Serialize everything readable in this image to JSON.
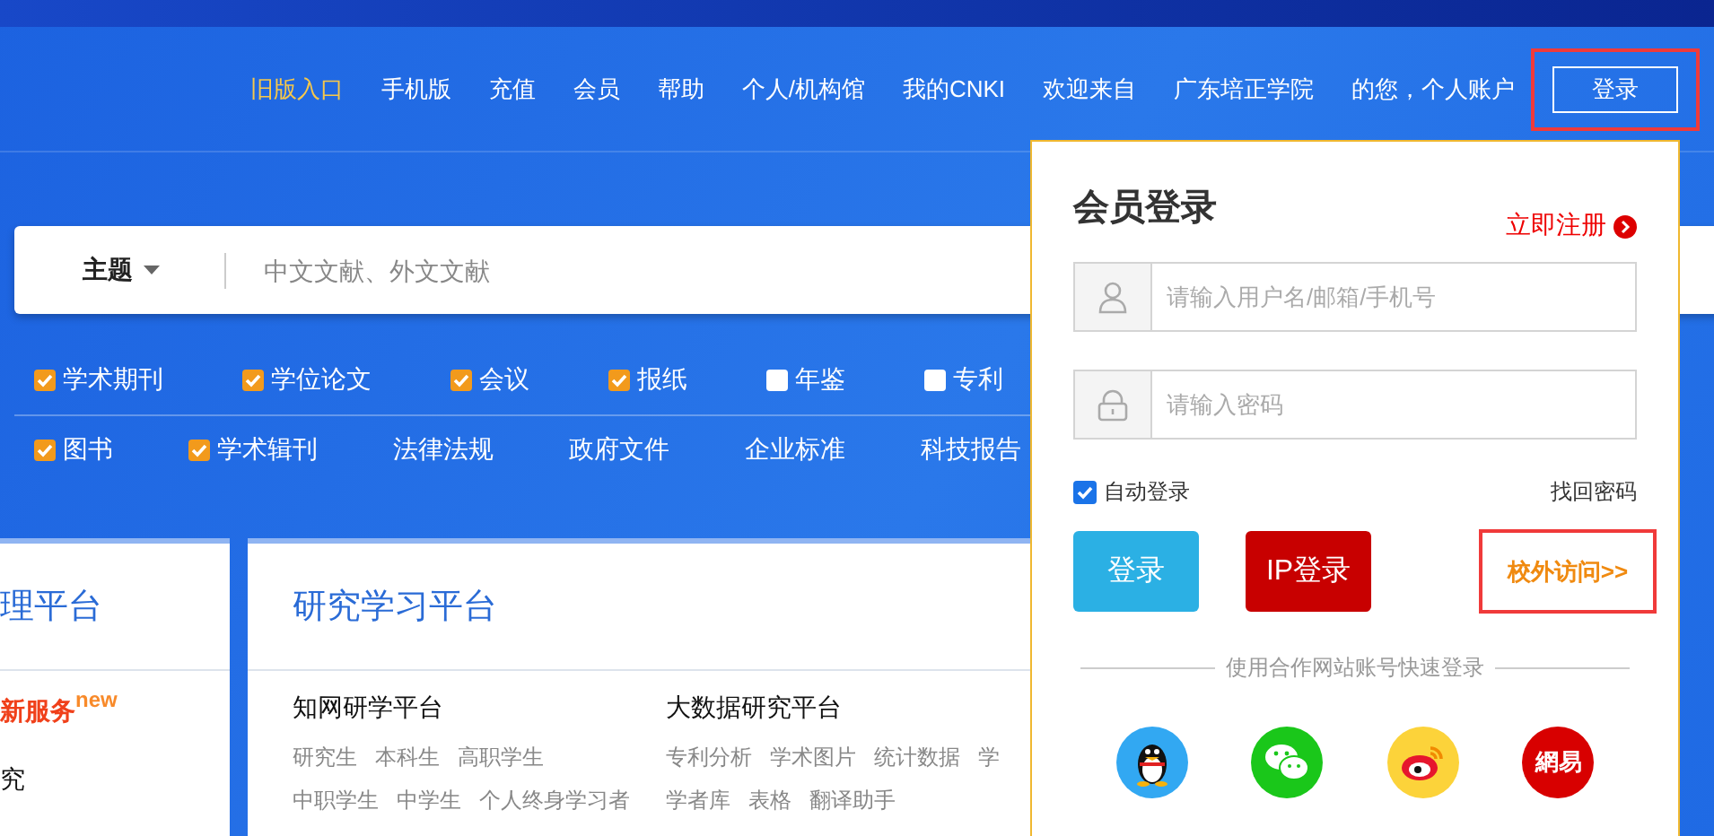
{
  "nav": {
    "links": [
      {
        "label": "旧版入口",
        "kind": "highlight"
      },
      {
        "label": "手机版",
        "kind": "plain"
      },
      {
        "label": "充值",
        "kind": "plain"
      },
      {
        "label": "会员",
        "kind": "plain"
      },
      {
        "label": "帮助",
        "kind": "plain"
      },
      {
        "label": "个人/机构馆",
        "kind": "plain"
      },
      {
        "label": "我的CNKI",
        "kind": "plain"
      }
    ],
    "welcome": "欢迎来自",
    "institution": "广东培正学院",
    "account": "的您，个人账户",
    "login_button": "登录"
  },
  "search": {
    "field_selector": "主题",
    "placeholder": "中文文献、外文文献"
  },
  "databases": [
    [
      {
        "label": "学术期刊",
        "kind": "checkbox",
        "checked": true
      },
      {
        "label": "学位论文",
        "kind": "checkbox",
        "checked": true
      },
      {
        "label": "会议",
        "kind": "checkbox",
        "checked": true
      },
      {
        "label": "报纸",
        "kind": "checkbox",
        "checked": true
      },
      {
        "label": "年鉴",
        "kind": "checkbox",
        "checked": false
      },
      {
        "label": "专利",
        "kind": "checkbox",
        "checked": false
      }
    ],
    [
      {
        "label": "图书",
        "kind": "checkbox",
        "checked": true
      },
      {
        "label": "学术辑刊",
        "kind": "checkbox",
        "checked": true
      },
      {
        "label": "法律法规",
        "kind": "link"
      },
      {
        "label": "政府文件",
        "kind": "link"
      },
      {
        "label": "企业标准",
        "kind": "link"
      },
      {
        "label": "科技报告",
        "kind": "link"
      }
    ]
  ],
  "panels": [
    {
      "title": "理平台",
      "sections": [
        {
          "heading": "新服务",
          "badge": "new",
          "kind": "promo"
        },
        {
          "heading": "究",
          "kind": "plain"
        }
      ]
    },
    {
      "title": "研究学习平台",
      "sections": [
        {
          "heading": "知网研学平台",
          "kind": "plain",
          "links": [
            [
              "研究生",
              "本科生",
              "高职学生"
            ],
            [
              "中职学生",
              "中学生",
              "个人终身学习者"
            ]
          ]
        },
        {
          "heading": "大数据研究平台",
          "kind": "plain",
          "links": [
            [
              "专利分析",
              "学术图片",
              "统计数据",
              "学"
            ],
            [
              "学者库",
              "表格",
              "翻译助手"
            ]
          ]
        }
      ]
    }
  ],
  "login": {
    "title": "会员登录",
    "register": "立即注册",
    "username_placeholder": "请输入用户名/邮箱/手机号",
    "password_placeholder": "请输入密码",
    "auto_login": {
      "label": "自动登录",
      "checked": true
    },
    "forgot_password": "找回密码",
    "login_button": "登录",
    "ip_login_button": "IP登录",
    "off_campus": "校外访问>>",
    "divider_text": "使用合作网站账号快速登录",
    "social": [
      {
        "kind": "qq"
      },
      {
        "kind": "wechat"
      },
      {
        "kind": "weibo"
      },
      {
        "kind": "netease",
        "text": "網易"
      }
    ]
  }
}
